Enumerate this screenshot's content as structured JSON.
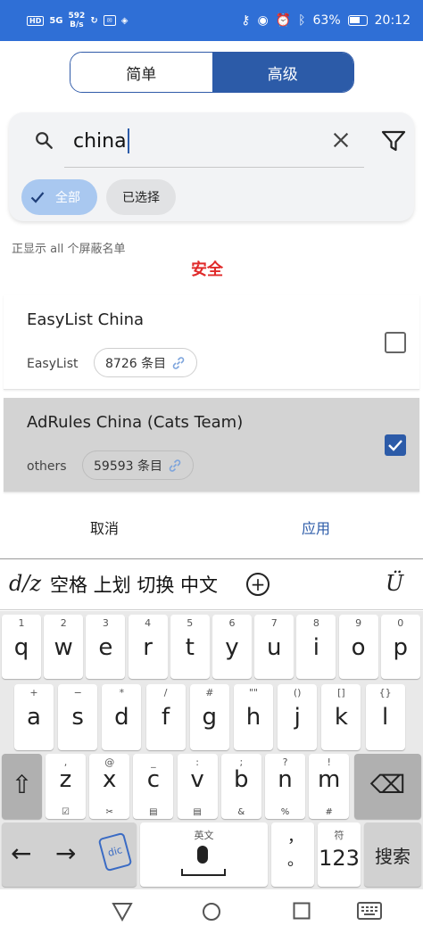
{
  "status_bar": {
    "hd": "HD",
    "signal": "5G",
    "speed_value": "592",
    "speed_unit": "B/s",
    "battery_percent": "63%",
    "time": "20:12"
  },
  "segment": {
    "simple": "简单",
    "advanced": "高级"
  },
  "search": {
    "value": "china"
  },
  "chips": {
    "all": "全部",
    "selected": "已选择"
  },
  "hint": "正显示 all 个屏蔽名单",
  "watermark": "安全",
  "list": [
    {
      "title": "EasyList China",
      "source": "EasyList",
      "count": "8726 条目",
      "checked": false
    },
    {
      "title": "AdRules China (Cats Team)",
      "source": "others",
      "count": "59593 条目",
      "checked": true
    }
  ],
  "actions": {
    "cancel": "取消",
    "apply": "应用"
  },
  "keyboard": {
    "logo": "d/z",
    "suggestion": "空格 上划 切换 中文",
    "plus": "+",
    "right_logo": "Ü",
    "row1": [
      {
        "sub": "1",
        "main": "q"
      },
      {
        "sub": "2",
        "main": "w"
      },
      {
        "sub": "3",
        "main": "e"
      },
      {
        "sub": "4",
        "main": "r"
      },
      {
        "sub": "5",
        "main": "t"
      },
      {
        "sub": "6",
        "main": "y"
      },
      {
        "sub": "7",
        "main": "u"
      },
      {
        "sub": "8",
        "main": "i"
      },
      {
        "sub": "9",
        "main": "o"
      },
      {
        "sub": "0",
        "main": "p"
      }
    ],
    "row2": [
      {
        "sub": "+",
        "main": "a"
      },
      {
        "sub": "−",
        "main": "s"
      },
      {
        "sub": "*",
        "main": "d"
      },
      {
        "sub": "/",
        "main": "f"
      },
      {
        "sub": "#",
        "main": "g"
      },
      {
        "sub": "\"\"",
        "main": "h"
      },
      {
        "sub": "()",
        "main": "j"
      },
      {
        "sub": "[]",
        "main": "k"
      },
      {
        "sub": "{}",
        "main": "l"
      }
    ],
    "row3": [
      {
        "sub": ",",
        "main": "z",
        "sub2": "☑"
      },
      {
        "sub": "@",
        "main": "x",
        "sub2": "✂"
      },
      {
        "sub": "_",
        "main": "c",
        "sub2": "▤"
      },
      {
        "sub": ":",
        "main": "v",
        "sub2": "▤"
      },
      {
        "sub": ";",
        "main": "b",
        "sub2": "&"
      },
      {
        "sub": "?",
        "main": "n",
        "sub2": "%"
      },
      {
        "sub": "!",
        "main": "m",
        "sub2": "#"
      }
    ],
    "shift": "⇧",
    "backspace": "⌫",
    "left_arrow": "←",
    "right_arrow": "→",
    "dict_label": "dic",
    "space_top": "英文",
    "punct": "，\n。",
    "sym_top": "符",
    "num": "123",
    "search_key": "搜索"
  },
  "colors": {
    "accent": "#2c5ba8",
    "status_bar": "#2f6fd6"
  }
}
